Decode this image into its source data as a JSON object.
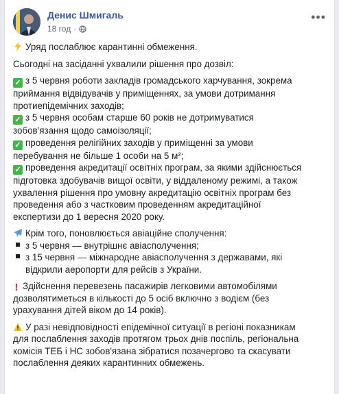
{
  "post": {
    "author": "Денис Шмигаль",
    "time": "18 год",
    "privacy_icon": "globe-icon",
    "paragraphs": [
      {
        "id": "p1",
        "lines": [
          "Уряд послаблює карантинні обмеження."
        ]
      },
      {
        "id": "p2",
        "lines": [
          "Сьогодні на засіданні ухвалили рішення про дозвіл:"
        ]
      },
      {
        "id": "p3",
        "lines": [
          "з 5 червня роботи закладів громадського харчування, зокрема",
          "приймання відвідувачів у приміщеннях, за умови дотримання",
          "протиепідемічних заходів;",
          "з 5 червня особам старше 60 років не дотримуватися",
          "зобов'язання щодо самоізоляції;",
          "проведення релігійних заходів у приміщенні за умови",
          "перебування не більше 1 особи на 5 м²;",
          "проведення акредитації освітніх програм, за якими здійснюється",
          "підготовка здобувачів вищої освіти, у віддаленому режимі, а також",
          "ухвалення рішення про умовну акредитацію освітніх програм без",
          "проведення або з частковим проведенням акредитаційної",
          "експертизи до 1 вересня 2020 року."
        ]
      },
      {
        "id": "p4",
        "lines": [
          "Крім того, поновлюється авіаційне сполучення:",
          "з 5 червня — внутрішнє авіасполучення;",
          "з 15 червня — міжнародне авіасполучення з державами, які",
          "відкрили аеропорти для рейсів з України."
        ]
      },
      {
        "id": "p5",
        "lines": [
          "Здійснення перевезень пасажирів легковими автомобілями",
          "дозволятиметься в кількості до 5 осіб включно з водієм (без",
          "урахування дітей віком до 14 років)."
        ]
      },
      {
        "id": "p6",
        "lines": [
          "У разі невідповідності епідемічної ситуації в регіоні показникам",
          "для послаблення заходів протягом трьох днів поспіль, регіональна",
          "комісія ТЕБ і НС зобов'язана зібратися позачергово та скасувати",
          "послаблення деяких карантинних обмежень."
        ]
      }
    ]
  },
  "icons": {
    "lightning": "lightning-emoji-icon",
    "check": "check-mark-icon",
    "airplane": "airplane-icon",
    "exclamation": "exclamation-icon",
    "warning": "warning-icon",
    "more": "more-options-icon"
  },
  "colors": {
    "author": "#385898",
    "check": "#43b649",
    "exclamation": "#e0263b",
    "warning": "#f7c431"
  }
}
